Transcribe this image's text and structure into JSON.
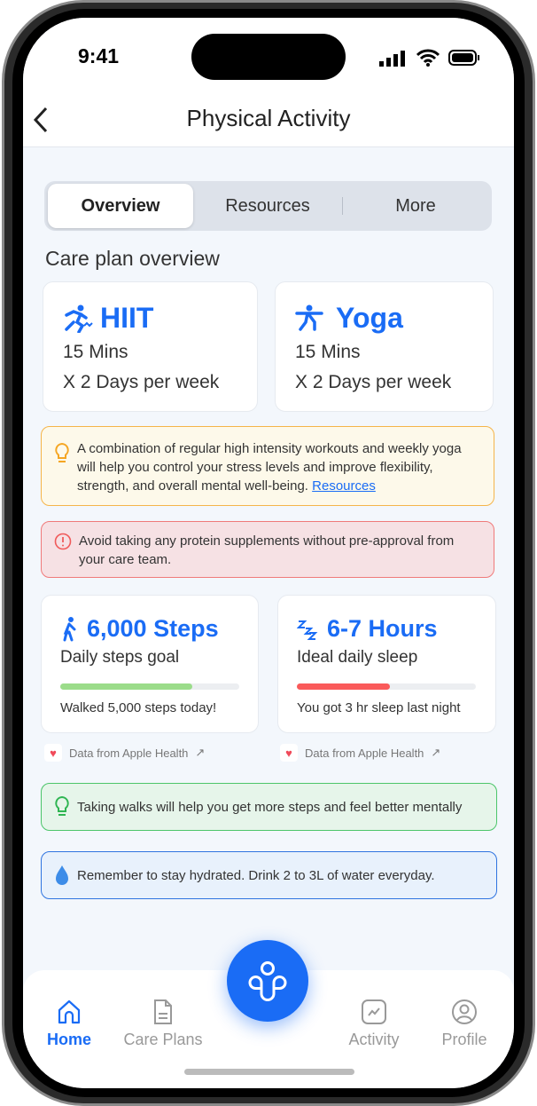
{
  "status_bar": {
    "time": "9:41"
  },
  "header": {
    "title": "Physical Activity"
  },
  "tabs": [
    {
      "label": "Overview",
      "active": true
    },
    {
      "label": "Resources"
    },
    {
      "label": "More"
    }
  ],
  "section_title": "Care plan overview",
  "plans": [
    {
      "icon": "hiit-runner-heart-icon",
      "name": "HIIT",
      "duration": "15 Mins",
      "frequency": "X 2 Days per week"
    },
    {
      "icon": "yoga-pose-icon",
      "name": "Yoga",
      "duration": "15 Mins",
      "frequency": "X 2 Days per week"
    }
  ],
  "tips": {
    "yellow": {
      "text": "A combination of regular high intensity workouts and weekly yoga will help you control your stress levels and improve flexibility, strength, and overall mental well-being.",
      "link": "Resources"
    },
    "red": {
      "text": "Avoid taking any protein supplements without pre-approval from your care team."
    },
    "green": {
      "text": "Taking walks will help you get more steps and feel better mentally"
    },
    "blue": {
      "text": "Remember to stay hydrated. Drink 2 to 3L of water everyday."
    }
  },
  "stats": [
    {
      "title": "6,000 Steps",
      "subtitle": "Daily steps goal",
      "progress": 0.74,
      "color": "#9bdc8a",
      "note": "Walked 5,000 steps today!",
      "source": "Data from Apple Health"
    },
    {
      "title": "6-7 Hours",
      "subtitle": "Ideal daily sleep",
      "progress": 0.52,
      "color": "#fa5a5a",
      "note": "You got 3 hr sleep last night",
      "source": "Data from Apple Health"
    }
  ],
  "nav": [
    {
      "label": "Home",
      "active": true
    },
    {
      "label": "Care Plans"
    },
    {
      "label": "Activity"
    },
    {
      "label": "Profile"
    }
  ],
  "colors": {
    "accent": "#1a6cf5"
  }
}
